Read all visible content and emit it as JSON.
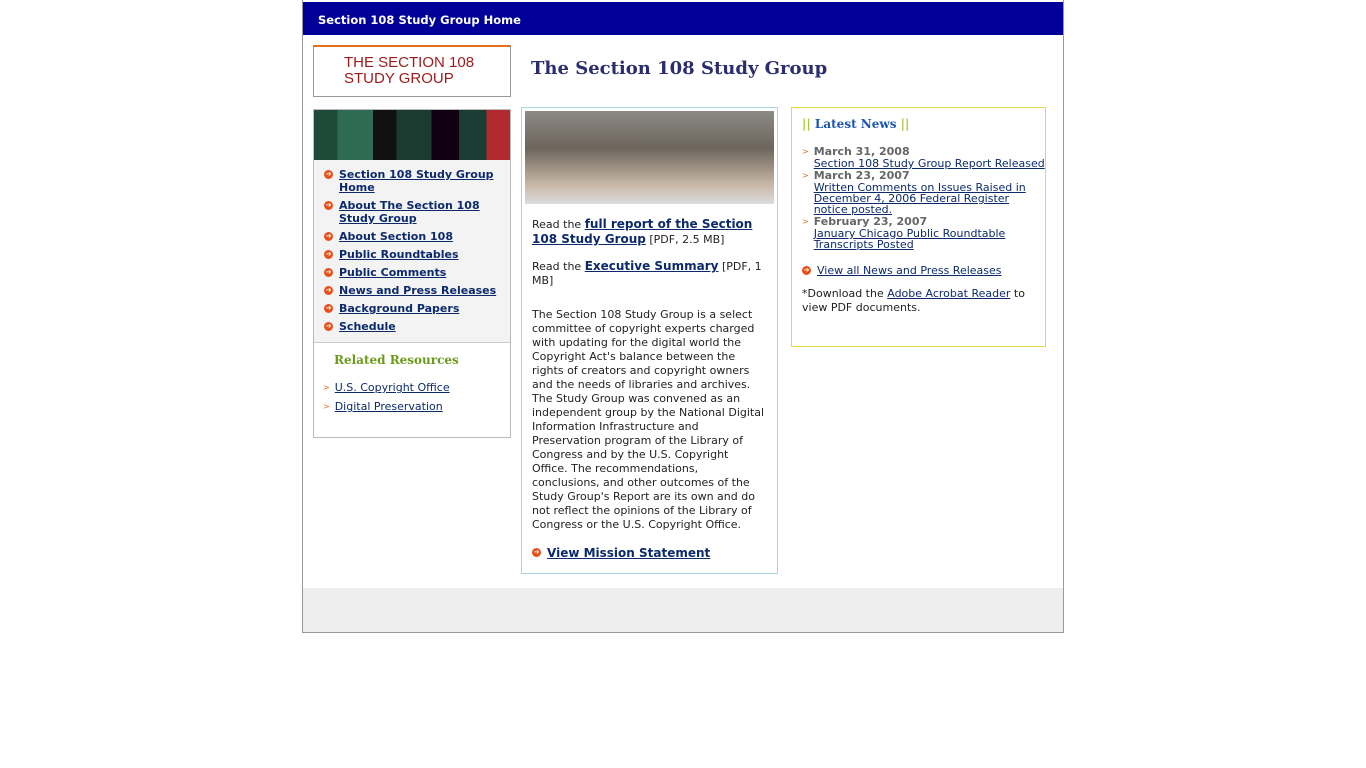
{
  "header": {
    "home_link": "Section 108 Study Group Home"
  },
  "logo": {
    "text": "THE SECTION 108 STUDY GROUP"
  },
  "page_title": "The Section 108 Study Group",
  "nav": [
    {
      "label": "Section 108 Study Group Home"
    },
    {
      "label": "About The Section 108 Study Group"
    },
    {
      "label": "About Section 108"
    },
    {
      "label": "Public Roundtables"
    },
    {
      "label": "Public Comments"
    },
    {
      "label": "News and Press Releases"
    },
    {
      "label": "Background Papers"
    },
    {
      "label": "Schedule"
    }
  ],
  "related": {
    "title": "Related Resources",
    "items": [
      {
        "label": "U.S. Copyright Office"
      },
      {
        "label": "Digital Preservation"
      }
    ]
  },
  "main": {
    "read1_prefix": "Read the ",
    "read1_link": "full report of the Section 108 Study Group",
    "read1_suffix": " [PDF, 2.5 MB]",
    "read2_prefix": "Read the ",
    "read2_link": "Executive Summary",
    "read2_suffix": " [PDF, 1 MB]",
    "description": "The Section 108 Study Group is a select committee of copyright experts charged with updating for the digital world the Copyright Act's balance between the rights of creators and copyright owners and the needs of libraries and archives. The Study Group was convened as an independent group by the National Digital Information Infrastructure and Preservation program of the Library of Congress and by the U.S. Copyright Office. The recommendations, conclusions, and other outcomes of the Study Group's Report are its own and do not reflect the opinions of the Library of Congress or the U.S. Copyright Office.",
    "mission_link": "View Mission Statement"
  },
  "news": {
    "bars": "||",
    "title": "Latest News",
    "items": [
      {
        "date": "March 31, 2008",
        "link": "Section 108 Study Group Report Released"
      },
      {
        "date": "March 23, 2007",
        "link": "Written Comments on Issues Raised in December 4, 2006 Federal Register notice posted."
      },
      {
        "date": "February 23, 2007",
        "link": "January Chicago Public Roundtable Transcripts Posted"
      }
    ],
    "view_all": "View all News and Press Releases",
    "note_prefix": "*Download the ",
    "note_link": "Adobe Acrobat Reader",
    "note_suffix": " to view PDF documents."
  },
  "colors": {
    "header_bg": "#000099",
    "title": "#2b2d6e",
    "link": "#0c2a6b",
    "accent": "#e8501a"
  }
}
